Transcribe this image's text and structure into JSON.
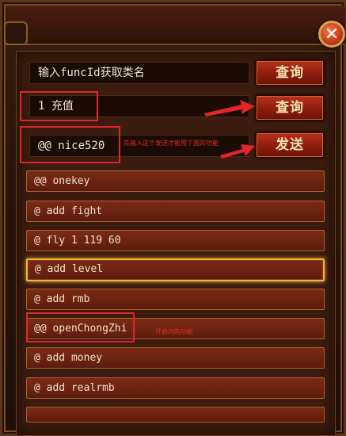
{
  "header": {
    "close_icon_glyph": "✕"
  },
  "query_class": {
    "input_value": "输入funcId获取类名",
    "button_label": "查询"
  },
  "query_recharge": {
    "input_value": "1 充值",
    "button_label": "查询"
  },
  "send": {
    "input_value": "@@ nice520",
    "button_label": "发送",
    "annotation": "先输入这个发送才能用下面的功能"
  },
  "commands": [
    {
      "label": "@@ onekey"
    },
    {
      "label": "@ add fight"
    },
    {
      "label": "@ fly 1 119 60"
    },
    {
      "label": "@ add level"
    },
    {
      "label": "@ add rmb"
    },
    {
      "label": "@@ openChongZhi",
      "annotation": "开启内购功能"
    },
    {
      "label": "@ add money"
    },
    {
      "label": "@ add realrmb"
    }
  ],
  "colors": {
    "button_red": "#8e1e0e",
    "highlight_red": "#e0262a",
    "active_gold": "#f2b23a"
  }
}
